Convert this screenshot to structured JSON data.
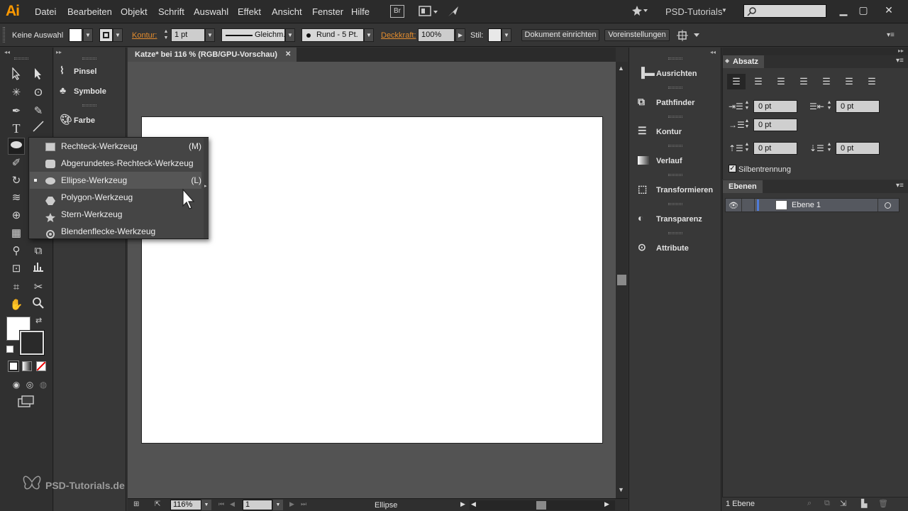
{
  "menubar": {
    "logo": "Ai",
    "items": [
      "Datei",
      "Bearbeiten",
      "Objekt",
      "Schrift",
      "Auswahl",
      "Effekt",
      "Ansicht",
      "Fenster",
      "Hilfe"
    ],
    "bridge_label": "Br",
    "workspace": "PSD-Tutorials",
    "window_controls": [
      "minimize-icon",
      "restore-icon",
      "close-icon"
    ]
  },
  "controlbar": {
    "selection_label": "Keine Auswahl",
    "kontur_label": "Kontur:",
    "stroke_weight": "1 pt",
    "stroke_profile": "Gleichm.",
    "brush": "Rund - 5 Pt.",
    "opacity_label": "Deckkraft:",
    "opacity_value": "100%",
    "style_label": "Stil:",
    "document_setup": "Dokument einrichten",
    "preferences": "Voreinstellungen"
  },
  "panelcol1": {
    "items": [
      {
        "label": "Pinsel",
        "icon": "brush-icon"
      },
      {
        "label": "Symbole",
        "icon": "club-icon"
      },
      {
        "label": "Farbe",
        "icon": "palette-icon"
      }
    ]
  },
  "document": {
    "tab_title": "Katze* bei 116 % (RGB/GPU-Vorschau)",
    "zoom": "116%",
    "page": "1",
    "status_tool": "Ellipse"
  },
  "flyout": {
    "items": [
      {
        "label": "Rechteck-Werkzeug",
        "shortcut": "(M)",
        "active": false
      },
      {
        "label": "Abgerundetes-Rechteck-Werkzeug",
        "shortcut": "",
        "active": false
      },
      {
        "label": "Ellipse-Werkzeug",
        "shortcut": "(L)",
        "active": true
      },
      {
        "label": "Polygon-Werkzeug",
        "shortcut": "",
        "active": false
      },
      {
        "label": "Stern-Werkzeug",
        "shortcut": "",
        "active": false
      },
      {
        "label": "Blendenflecke-Werkzeug",
        "shortcut": "",
        "active": false
      }
    ]
  },
  "panelcol2": {
    "items": [
      {
        "label": "Ausrichten",
        "icon": "align-icon"
      },
      {
        "label": "Pathfinder",
        "icon": "pathfinder-icon"
      },
      {
        "label": "Kontur",
        "icon": "stroke-icon"
      },
      {
        "label": "Verlauf",
        "icon": "gradient-icon"
      },
      {
        "label": "Transformieren",
        "icon": "transform-icon"
      },
      {
        "label": "Transparenz",
        "icon": "transparency-icon"
      },
      {
        "label": "Attribute",
        "icon": "attributes-icon"
      }
    ]
  },
  "absatz": {
    "title": "Absatz",
    "fields": {
      "left_indent": "0 pt",
      "right_indent": "0 pt",
      "first_line_indent": "0 pt",
      "space_before": "0 pt",
      "space_after": "0 pt"
    },
    "hyphenation_label": "Silbentrennung",
    "hyphenation_checked": true
  },
  "ebenen": {
    "title": "Ebenen",
    "layers": [
      {
        "name": "Ebene 1",
        "color": "#4f7bd8"
      }
    ],
    "footer_count": "1 Ebene"
  },
  "watermark": "PSD-Tutorials.de"
}
